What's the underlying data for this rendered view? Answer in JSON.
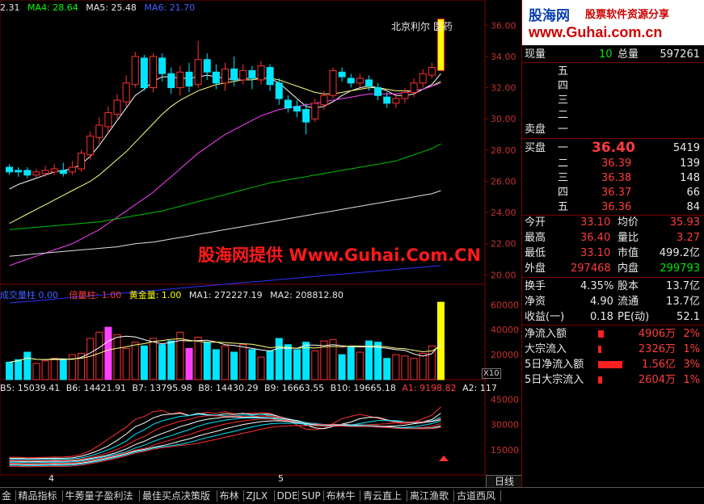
{
  "top_indicators": {
    "ma_prefix": "2.31",
    "ma4": "MA4: 28.64",
    "ma5": "MA5: 25.48",
    "ma6": "MA6: 21.70",
    "stock_label": "北京利尔 医药",
    "colors": {
      "ma4": "#00ff00",
      "ma5": "#ffffff",
      "ma6": "#4040ff"
    }
  },
  "price_axis": [
    "36.00",
    "34.00",
    "32.00",
    "30.00",
    "28.00",
    "26.00",
    "24.00",
    "22.00",
    "20.00"
  ],
  "watermark": "股海网提供 Www.Guhai.Com.CN",
  "volume_header": {
    "name": "成交量柱 0.00",
    "bei": "倍量柱: 1.00",
    "gold": "黄金量: 1.00",
    "ma1": "MA1: 272227.19",
    "ma2": "MA2: 208812.80"
  },
  "volume_axis": [
    "60000",
    "40000",
    "20000"
  ],
  "volume_unit": "X10",
  "lower_header": {
    "b5": "B5: 15039.41",
    "b6": "B6: 14421.91",
    "b7": "B7: 13795.98",
    "b8": "B8: 14430.29",
    "b9": "B9: 16663.55",
    "b10": "B10: 19665.18",
    "a1": "A1: 9198.82",
    "a2": "A2: 117"
  },
  "lower_axis": [
    "45000",
    "30000",
    "15000"
  ],
  "month_labels": [
    "4",
    "5"
  ],
  "day_button": "日线",
  "brand": {
    "logo": "股海网",
    "slogan": "股票软件资源分享",
    "url": "www.Guhai.com.cn"
  },
  "quote": {
    "now_label": "现量",
    "now_val": "10",
    "total_label": "总量",
    "total_val": "597261",
    "sell_labels": [
      "五",
      "四",
      "三",
      "二",
      "一"
    ],
    "sell_side": "卖盘",
    "buy_side": "买盘",
    "buy_labels": [
      "一",
      "二",
      "三",
      "四",
      "五"
    ],
    "buy_prices": [
      "36.40",
      "36.39",
      "36.38",
      "36.37",
      "36.36"
    ],
    "buy_vols": [
      "5419",
      "139",
      "148",
      "66",
      "84"
    ]
  },
  "stats": [
    {
      "l1": "今开",
      "v1": "33.10",
      "l2": "均价",
      "v2": "35.93"
    },
    {
      "l1": "最高",
      "v1": "36.40",
      "l2": "量比",
      "v2": "3.27"
    },
    {
      "l1": "最低",
      "v1": "33.10",
      "l2": "市值",
      "v2": "499.2亿"
    },
    {
      "l1": "外盘",
      "v1": "297468",
      "l2": "内盘",
      "v2": "299793"
    }
  ],
  "stats2": [
    {
      "l1": "换手",
      "v1": "4.35%",
      "l2": "股本",
      "v2": "13.7亿"
    },
    {
      "l1": "净资",
      "v1": "4.90",
      "l2": "流通",
      "v2": "13.7亿"
    },
    {
      "l1": "收益(一)",
      "v1": "0.18",
      "l2": "PE(动)",
      "v2": "52.1"
    }
  ],
  "flows": [
    {
      "label": "净流入额",
      "value": "4906万",
      "pct": "2%",
      "bar": 0.12
    },
    {
      "label": "大宗流入",
      "value": "2326万",
      "pct": "1%",
      "bar": 0.06
    },
    {
      "label": "5日净流入额",
      "value": "1.56亿",
      "pct": "3%",
      "bar": 0.5
    },
    {
      "label": "5日大宗流入",
      "value": "2604万",
      "pct": "1%",
      "bar": 0.08
    }
  ],
  "tabs": [
    "金",
    "精品指标",
    "牛莠量子盈利法",
    "最佳买点决策版",
    "布林",
    "ZJLX",
    "DDE",
    "SUP",
    "布林牛",
    "青云直上",
    "离江渔歌",
    "古道西风"
  ],
  "chart_data": {
    "type": "candlestick",
    "ylim": [
      19.5,
      37
    ],
    "candles": [
      {
        "o": 26.9,
        "c": 26.6,
        "h": 27.1,
        "l": 26.4
      },
      {
        "o": 26.7,
        "c": 26.6,
        "h": 26.9,
        "l": 26.3
      },
      {
        "o": 26.7,
        "c": 26.4,
        "h": 26.9,
        "l": 26.2
      },
      {
        "o": 26.4,
        "c": 26.6,
        "h": 26.8,
        "l": 26.2
      },
      {
        "o": 26.5,
        "c": 26.7,
        "h": 27.0,
        "l": 26.3
      },
      {
        "o": 26.6,
        "c": 26.8,
        "h": 27.1,
        "l": 26.4
      },
      {
        "o": 26.7,
        "c": 26.5,
        "h": 27.2,
        "l": 26.3
      },
      {
        "o": 26.6,
        "c": 26.9,
        "h": 27.3,
        "l": 26.4
      },
      {
        "o": 26.8,
        "c": 27.8,
        "h": 28.0,
        "l": 26.6
      },
      {
        "o": 27.7,
        "c": 28.9,
        "h": 29.2,
        "l": 27.4
      },
      {
        "o": 28.8,
        "c": 29.6,
        "h": 30.1,
        "l": 28.4
      },
      {
        "o": 29.5,
        "c": 30.4,
        "h": 30.8,
        "l": 29.1
      },
      {
        "o": 30.3,
        "c": 31.2,
        "h": 31.6,
        "l": 30.0
      },
      {
        "o": 31.1,
        "c": 32.3,
        "h": 32.8,
        "l": 30.8
      },
      {
        "o": 32.2,
        "c": 34.0,
        "h": 34.3,
        "l": 32.0
      },
      {
        "o": 33.9,
        "c": 32.0,
        "h": 34.1,
        "l": 31.8
      },
      {
        "o": 32.0,
        "c": 34.0,
        "h": 34.2,
        "l": 31.7
      },
      {
        "o": 33.9,
        "c": 32.9,
        "h": 34.2,
        "l": 32.4
      },
      {
        "o": 32.9,
        "c": 32.0,
        "h": 33.3,
        "l": 31.6
      },
      {
        "o": 32.0,
        "c": 33.0,
        "h": 33.4,
        "l": 31.5
      },
      {
        "o": 33.0,
        "c": 32.1,
        "h": 33.6,
        "l": 31.7
      },
      {
        "o": 32.2,
        "c": 33.8,
        "h": 35.0,
        "l": 32.0
      },
      {
        "o": 33.8,
        "c": 33.0,
        "h": 34.2,
        "l": 32.5
      },
      {
        "o": 33.0,
        "c": 32.3,
        "h": 33.5,
        "l": 31.9
      },
      {
        "o": 32.3,
        "c": 33.2,
        "h": 33.6,
        "l": 31.8
      },
      {
        "o": 33.2,
        "c": 32.5,
        "h": 34.0,
        "l": 32.1
      },
      {
        "o": 32.5,
        "c": 33.1,
        "h": 33.5,
        "l": 32.2
      },
      {
        "o": 33.1,
        "c": 32.6,
        "h": 33.4,
        "l": 31.9
      },
      {
        "o": 32.5,
        "c": 33.4,
        "h": 33.7,
        "l": 32.2
      },
      {
        "o": 33.3,
        "c": 32.2,
        "h": 33.5,
        "l": 31.8
      },
      {
        "o": 32.3,
        "c": 31.3,
        "h": 32.6,
        "l": 30.9
      },
      {
        "o": 31.2,
        "c": 30.7,
        "h": 31.5,
        "l": 30.4
      },
      {
        "o": 30.8,
        "c": 30.5,
        "h": 31.2,
        "l": 30.1
      },
      {
        "o": 30.6,
        "c": 29.8,
        "h": 31.0,
        "l": 29.0
      },
      {
        "o": 30.0,
        "c": 31.0,
        "h": 31.3,
        "l": 29.8
      },
      {
        "o": 30.9,
        "c": 31.5,
        "h": 31.8,
        "l": 30.6
      },
      {
        "o": 31.5,
        "c": 33.1,
        "h": 33.3,
        "l": 31.3
      },
      {
        "o": 33.0,
        "c": 32.7,
        "h": 33.3,
        "l": 32.4
      },
      {
        "o": 32.6,
        "c": 32.3,
        "h": 32.9,
        "l": 32.0
      },
      {
        "o": 32.3,
        "c": 32.6,
        "h": 32.9,
        "l": 32.0
      },
      {
        "o": 32.5,
        "c": 32.1,
        "h": 32.8,
        "l": 31.8
      },
      {
        "o": 32.0,
        "c": 31.5,
        "h": 32.3,
        "l": 31.2
      },
      {
        "o": 31.4,
        "c": 31.0,
        "h": 31.7,
        "l": 30.7
      },
      {
        "o": 31.0,
        "c": 31.3,
        "h": 31.6,
        "l": 30.7
      },
      {
        "o": 31.3,
        "c": 31.7,
        "h": 32.0,
        "l": 31.0
      },
      {
        "o": 31.7,
        "c": 32.3,
        "h": 32.6,
        "l": 31.4
      },
      {
        "o": 32.3,
        "c": 32.9,
        "h": 33.2,
        "l": 32.0
      },
      {
        "o": 32.8,
        "c": 33.3,
        "h": 33.6,
        "l": 32.6
      },
      {
        "o": 33.1,
        "c": 36.4,
        "h": 36.4,
        "l": 33.1
      }
    ],
    "ma_lines": [
      {
        "color": "#ffffff",
        "values": [
          25.5,
          25.8,
          26.0,
          26.2,
          26.4,
          26.6,
          26.7,
          26.8,
          27.1,
          27.6,
          28.3,
          29.1,
          29.9,
          30.7,
          31.5,
          31.9,
          32.4,
          32.7,
          32.7,
          32.6,
          32.6,
          32.7,
          32.8,
          32.7,
          32.6,
          32.5,
          32.6,
          32.6,
          32.6,
          32.6,
          32.3,
          31.8,
          31.3,
          30.8,
          30.7,
          30.8,
          31.1,
          31.5,
          31.8,
          32.0,
          32.1,
          32.0,
          31.8,
          31.5,
          31.5,
          31.6,
          31.9,
          32.2,
          32.9
        ]
      },
      {
        "color": "#ffff80",
        "values": [
          23.3,
          23.6,
          23.9,
          24.2,
          24.5,
          24.8,
          25.1,
          25.4,
          25.7,
          26.0,
          26.4,
          26.9,
          27.4,
          27.9,
          28.5,
          29.1,
          29.7,
          30.3,
          30.8,
          31.2,
          31.5,
          31.8,
          32.0,
          32.2,
          32.3,
          32.4,
          32.5,
          32.5,
          32.6,
          32.6,
          32.5,
          32.3,
          32.1,
          31.9,
          31.7,
          31.6,
          31.6,
          31.7,
          31.8,
          31.9,
          32.0,
          32.0,
          31.9,
          31.8,
          31.8,
          31.8,
          31.9,
          32.1,
          32.4
        ]
      },
      {
        "color": "#ff40ff",
        "values": [
          20.6,
          20.8,
          21.0,
          21.2,
          21.4,
          21.6,
          21.8,
          22.0,
          22.3,
          22.6,
          22.9,
          23.3,
          23.7,
          24.1,
          24.5,
          24.9,
          25.3,
          25.8,
          26.3,
          26.8,
          27.3,
          27.8,
          28.2,
          28.6,
          29.0,
          29.3,
          29.6,
          29.9,
          30.2,
          30.4,
          30.6,
          30.7,
          30.8,
          30.9,
          31.0,
          31.1,
          31.2,
          31.3,
          31.4,
          31.5,
          31.6,
          31.6,
          31.6,
          31.6,
          31.7,
          31.8,
          31.9,
          32.1,
          32.3
        ]
      },
      {
        "color": "#00c000",
        "values": [
          22.9,
          22.95,
          23.0,
          23.05,
          23.1,
          23.15,
          23.2,
          23.25,
          23.3,
          23.35,
          23.4,
          23.5,
          23.6,
          23.7,
          23.8,
          23.9,
          24.0,
          24.1,
          24.25,
          24.4,
          24.55,
          24.7,
          24.85,
          25.0,
          25.15,
          25.3,
          25.45,
          25.6,
          25.75,
          25.9,
          26.0,
          26.1,
          26.2,
          26.3,
          26.4,
          26.5,
          26.6,
          26.7,
          26.8,
          26.9,
          27.0,
          27.1,
          27.2,
          27.3,
          27.5,
          27.7,
          27.9,
          28.1,
          28.4
        ]
      },
      {
        "color": "#e0e0e0",
        "values": [
          21.2,
          21.25,
          21.3,
          21.35,
          21.4,
          21.45,
          21.5,
          21.55,
          21.6,
          21.65,
          21.7,
          21.75,
          21.8,
          21.9,
          22.0,
          22.05,
          22.1,
          22.2,
          22.3,
          22.4,
          22.5,
          22.6,
          22.7,
          22.8,
          22.9,
          23.0,
          23.1,
          23.2,
          23.3,
          23.4,
          23.5,
          23.6,
          23.7,
          23.8,
          23.9,
          24.0,
          24.1,
          24.2,
          24.3,
          24.4,
          24.5,
          24.6,
          24.7,
          24.8,
          24.9,
          25.0,
          25.1,
          25.2,
          25.4
        ]
      },
      {
        "color": "#3030ff",
        "values": [
          18.2,
          18.25,
          18.3,
          18.35,
          18.4,
          18.45,
          18.5,
          18.55,
          18.6,
          18.65,
          18.7,
          18.75,
          18.8,
          18.85,
          18.9,
          18.95,
          19.0,
          19.05,
          19.1,
          19.15,
          19.2,
          19.25,
          19.3,
          19.35,
          19.4,
          19.45,
          19.5,
          19.55,
          19.6,
          19.65,
          19.7,
          19.75,
          19.8,
          19.85,
          19.9,
          19.95,
          20.0,
          20.05,
          20.1,
          20.15,
          20.2,
          20.25,
          20.3,
          20.35,
          20.4,
          20.45,
          20.5,
          20.55,
          20.6
        ]
      }
    ],
    "volumes": [
      14000,
      16000,
      22000,
      13000,
      15000,
      17000,
      16000,
      20000,
      21000,
      33000,
      38000,
      42000,
      36000,
      25000,
      30000,
      27000,
      33000,
      28000,
      31000,
      38000,
      25000,
      34000,
      30000,
      24000,
      27000,
      22000,
      28000,
      24000,
      18000,
      23000,
      33000,
      28000,
      24000,
      30000,
      23000,
      31000,
      32000,
      20000,
      26000,
      22000,
      31000,
      30000,
      17000,
      20000,
      19000,
      17000,
      21000,
      27000,
      62000
    ],
    "vol_ylim": [
      0,
      66000
    ]
  }
}
